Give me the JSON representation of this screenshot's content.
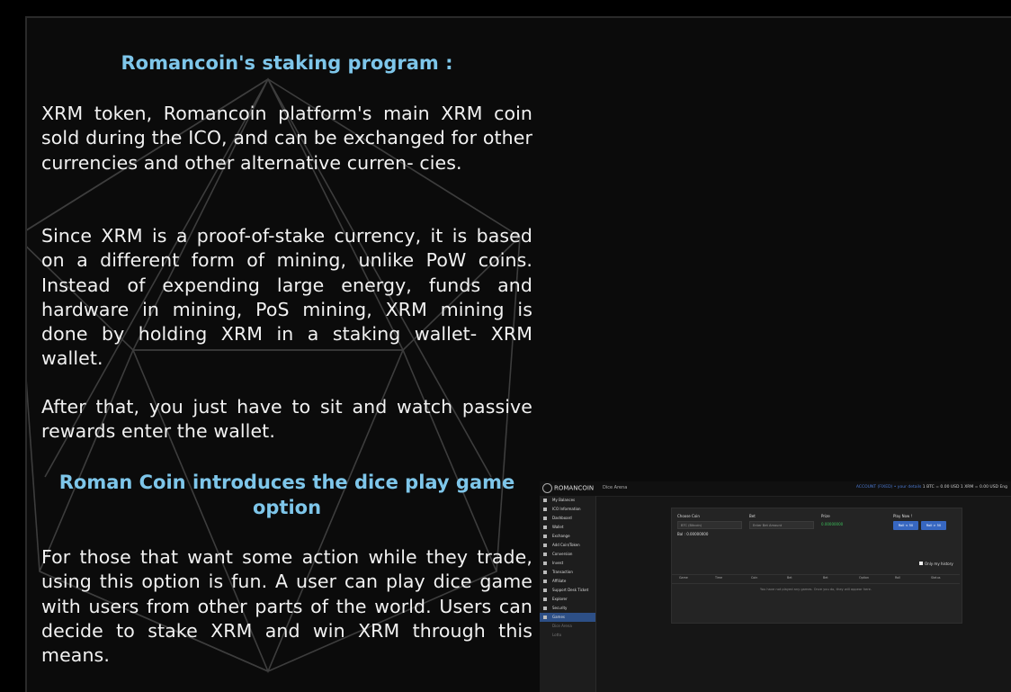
{
  "article": {
    "heading1": "Romancoin's staking program :",
    "para1": "XRM token, Romancoin platform's main XRM coin sold during the ICO, and can be exchanged for other currencies and other alternative curren- cies.",
    "para2": "Since XRM is a proof-of-stake currency, it is based on a different form of mining, unlike PoW coins. Instead of expending large energy, funds and hardware in mining, PoS mining, XRM mining is done by holding XRM in a staking wallet- XRM wallet.",
    "para3": "After that, you just have to sit and watch passive rewards enter the wallet.",
    "heading2": "Roman Coin introduces the dice play game option",
    "para4": "For those that want some action while they trade, using this option is fun. A user can play dice game with users from other parts of the world. Users can decide to stake XRM and win XRM through this means."
  },
  "colors": {
    "heading": "#7ec6ea",
    "text": "#f2f2f2",
    "background": "#0b0b0b",
    "accent": "#3767c1"
  },
  "embedded_app": {
    "logo": "ROMANCOIN",
    "breadcrumb": "Dice Arena",
    "account_text": "ACCOUNT (FIXED) • your details",
    "rates": "1 BTC = 0.00 USD   1 XRM = 0.00 USD   Eng",
    "sidebar": [
      {
        "label": "My Balances",
        "icon": "wallet-icon",
        "active": false,
        "sub": false
      },
      {
        "label": "ICO Information",
        "icon": "info-icon",
        "active": false,
        "sub": false
      },
      {
        "label": "Dashboard",
        "icon": "dashboard-icon",
        "active": false,
        "sub": false
      },
      {
        "label": "Wallet",
        "icon": "wallet-icon",
        "active": false,
        "sub": false
      },
      {
        "label": "Exchange",
        "icon": "exchange-icon",
        "active": false,
        "sub": false
      },
      {
        "label": "Add Coin/Token",
        "icon": "plus-icon",
        "active": false,
        "sub": false
      },
      {
        "label": "Conversion",
        "icon": "convert-icon",
        "active": false,
        "sub": false
      },
      {
        "label": "Invest",
        "icon": "invest-icon",
        "active": false,
        "sub": false
      },
      {
        "label": "Transaction",
        "icon": "list-icon",
        "active": false,
        "sub": false
      },
      {
        "label": "Affiliate",
        "icon": "share-icon",
        "active": false,
        "sub": false
      },
      {
        "label": "Support Desk Ticket",
        "icon": "ticket-icon",
        "active": false,
        "sub": false
      },
      {
        "label": "Explorer",
        "icon": "explorer-icon",
        "active": false,
        "sub": false
      },
      {
        "label": "Security",
        "icon": "lock-icon",
        "active": false,
        "sub": false
      },
      {
        "label": "Games",
        "icon": "game-icon",
        "active": true,
        "sub": false
      },
      {
        "label": "Dice Arena",
        "icon": "",
        "active": false,
        "sub": true
      },
      {
        "label": "Lotto",
        "icon": "",
        "active": false,
        "sub": true
      }
    ],
    "game": {
      "choose_coin_label": "Choose Coin",
      "coin_value": "BTC (Bitcoin)",
      "balance": "Bal : 0.00000000",
      "bet_label": "Bet",
      "bet_placeholder": "Enter Bet Amount",
      "prize_label": "Prize",
      "prize_value": "0.00000000",
      "play_label": "Play Now !",
      "roll_under": "Roll < 50",
      "roll_over": "Roll > 50",
      "history_label": "Only my history",
      "columns": [
        "Game",
        "Time",
        "Coin",
        "Bet",
        "Bet",
        "Option",
        "Roll",
        "Status"
      ],
      "empty_text": "You have not played any games. Once you do, they will appear here."
    }
  }
}
